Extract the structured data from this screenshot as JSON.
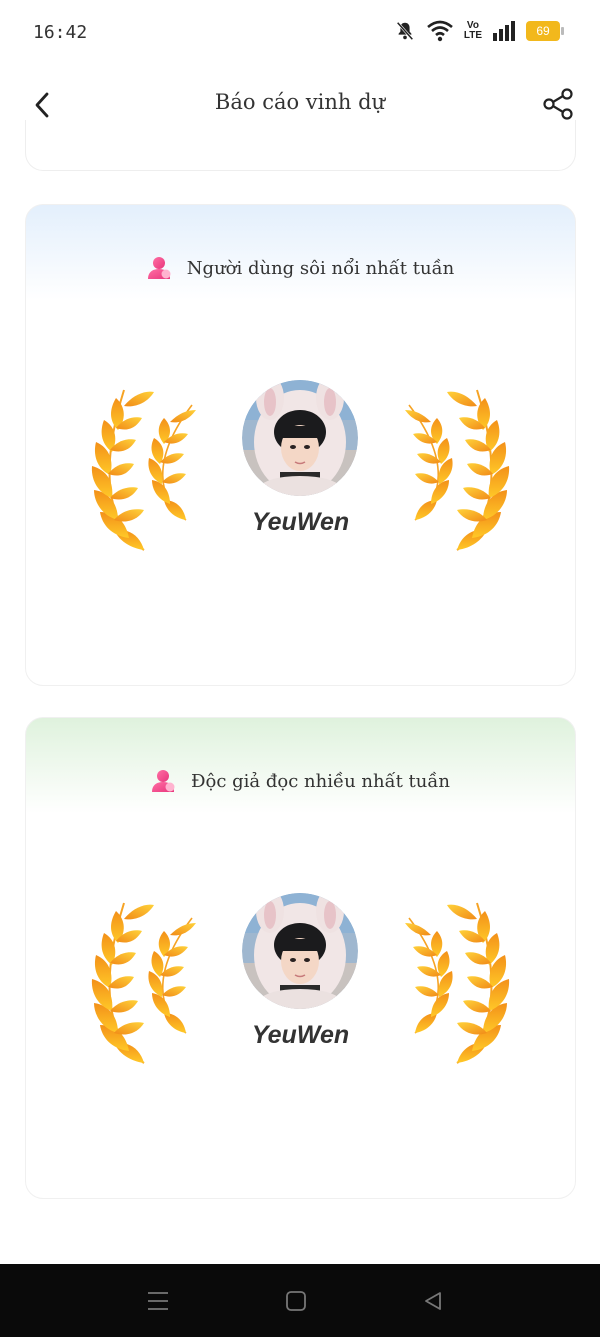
{
  "status": {
    "time": "16:42",
    "network": {
      "line1": "Vo",
      "line2": "LTE"
    },
    "battery": "69"
  },
  "header": {
    "title": "Báo cáo vinh dự"
  },
  "cards": [
    {
      "title": "Người dùng sôi nổi nhất tuần",
      "winner_name": "YeuWen"
    },
    {
      "title": "Độc giả đọc nhiều nhất tuần",
      "winner_name": "YeuWen"
    }
  ],
  "icons": {
    "back": "chevron-left-icon",
    "share": "share-icon",
    "user": "user-icon",
    "laurel": "laurel-wreath-icon"
  },
  "colors": {
    "accent_pink": "#e8357c",
    "laurel_orange": "#f39019",
    "laurel_yellow": "#ffc928",
    "blue_header": "#e3effc",
    "green_header": "#dff2dd"
  }
}
